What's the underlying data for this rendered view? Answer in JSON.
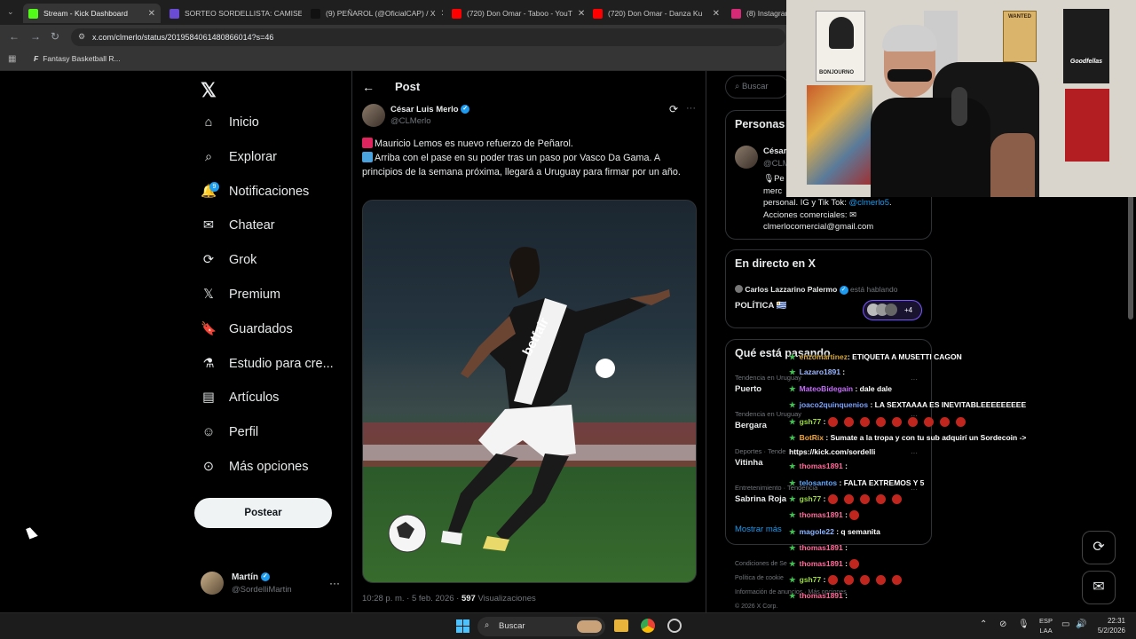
{
  "browser": {
    "tabs": [
      {
        "title": "Stream - Kick Dashboard",
        "color": "#53fc18"
      },
      {
        "title": "SORTEO SORDELLISTA: CAMISE",
        "color": "#6a4bd6"
      },
      {
        "title": "(9) PEÑAROL (@OficialCAP) / X",
        "color": "#111111"
      },
      {
        "title": "(720) Don Omar - Taboo - YouT",
        "color": "#ff0000"
      },
      {
        "title": "(720) Don Omar - Danza Ku",
        "color": "#ff0000"
      },
      {
        "title": "(8) Instagram",
        "color": "#d62976"
      }
    ],
    "url": "x.com/clmerlo/status/2019584061480866014?s=46",
    "bookmark": "Fantasy Basketball R..."
  },
  "nav": {
    "items": [
      {
        "label": "Inicio",
        "icon": "home-icon"
      },
      {
        "label": "Explorar",
        "icon": "search-icon"
      },
      {
        "label": "Notificaciones",
        "icon": "bell-icon"
      },
      {
        "label": "Chatear",
        "icon": "mail-icon"
      },
      {
        "label": "Grok",
        "icon": "grok-icon"
      },
      {
        "label": "Premium",
        "icon": "x-logo-icon"
      },
      {
        "label": "Guardados",
        "icon": "bookmark-icon"
      },
      {
        "label": "Estudio para cre...",
        "icon": "flask-icon"
      },
      {
        "label": "Artículos",
        "icon": "article-icon"
      },
      {
        "label": "Perfil",
        "icon": "person-icon"
      },
      {
        "label": "Más opciones",
        "icon": "more-icon"
      }
    ],
    "notification_badge": "9",
    "post_button": "Postear",
    "account": {
      "name": "Martín",
      "handle": "@SordelliMartin"
    }
  },
  "post": {
    "header": "Post",
    "author": "César Luis Merlo",
    "handle": "@CLMerlo",
    "line1": "Mauricio Lemos es nuevo refuerzo de Peñarol.",
    "line2": "Arriba con el pase en su poder tras un paso por Vasco Da Gama. A principios de la semana próxima, llegará a Uruguay para firmar por un año.",
    "timestamp": "10:28 p. m. · 5 feb. 2026 · ",
    "views_count": "597",
    "views_label": "Visualizaciones",
    "jersey_text": "betfair"
  },
  "right": {
    "search_placeholder": "Buscar",
    "personas_title": "Personas",
    "person_name": "César",
    "person_handle": "@CLM",
    "bio1": "Pe",
    "bio2": "merc",
    "bio3": "personal. IG y Tik Tok: ",
    "bio_link": "@clmerlo5",
    "bio4": "Acciones comerciales: ",
    "bio5": "clmerlocomercial@gmail.com",
    "live_title": "En directo en X",
    "live_host": "Carlos Lazzarino Palermo",
    "live_status": "está hablando",
    "live_topic": "POLÍTICA",
    "live_count": "+4",
    "trends_title": "Qué está pasando",
    "trends": [
      {
        "context": "Tendencia en Uruguay",
        "name": "Puerto"
      },
      {
        "context": "Tendencia en Uruguay",
        "name": "Bergara"
      },
      {
        "context": "Deportes · Tende",
        "name": "Vitinha"
      },
      {
        "context": "Entretenimiento · Tendencia",
        "name": "Sabrina Roja"
      }
    ],
    "show_more": "Mostrar más",
    "footer1": "Condiciones de Se",
    "footer2": "Política de cookie",
    "footer3": "Información de anuncios",
    "footer3b": "Más opciones",
    "footer4": "© 2026 X Corp."
  },
  "webcam": {
    "poster_left": "BONJOURNO",
    "poster_wanted": "WANTED",
    "poster_goodfellas": "Goodfellas"
  },
  "chat": [
    {
      "user": "enzomartinez",
      "msg": ": ETIQUETA A MUSETTI CAGON",
      "color": "#d6a636",
      "emotes": 0
    },
    {
      "user": "Lazaro1891",
      "msg": " : ",
      "color": "#9bb7ff",
      "emotes": 0
    },
    {
      "user": "MateoBidegain",
      "msg": " : dale dale",
      "color": "#c86bff",
      "emotes": 0
    },
    {
      "user": "joaco2quinquenios",
      "msg": " : LA SEXTAAAA ES INEVITABLEEEEEEEEE",
      "color": "#7aa2ff",
      "emotes": 0
    },
    {
      "user": "gsh77",
      "msg": " : ",
      "color": "#9cdc3b",
      "emotes": 9
    },
    {
      "user": "BotRix",
      "msg": " : Sumate a la tropa y con tu sub adquirí un Sordecoin ->",
      "color": "#f0a63b",
      "emotes": 0
    },
    {
      "user": "",
      "msg": "https://kick.com/sordelli",
      "color": "#ffffff",
      "emotes": 0
    },
    {
      "user": "thomas1891",
      "msg": " : ",
      "color": "#ff6b9b",
      "emotes": 0
    },
    {
      "user": "telosantos",
      "msg": " : FALTA EXTREMOS Y 5",
      "color": "#5fa8ff",
      "emotes": 0
    },
    {
      "user": "gsh77",
      "msg": " : ",
      "color": "#9cdc3b",
      "emotes": 5
    },
    {
      "user": "thomas1891",
      "msg": " : ",
      "color": "#ff6b9b",
      "emotes": 1
    },
    {
      "user": "magole22",
      "msg": " : q semanita",
      "color": "#8ab4ff",
      "emotes": 0
    },
    {
      "user": "thomas1891",
      "msg": " : ",
      "color": "#ff6b9b",
      "emotes": 0
    },
    {
      "user": "thomas1891",
      "msg": " : ",
      "color": "#ff6b9b",
      "emotes": 1
    },
    {
      "user": "gsh77",
      "msg": " : ",
      "color": "#9cdc3b",
      "emotes": 5
    },
    {
      "user": "thomas1891",
      "msg": " : ",
      "color": "#ff6b9b",
      "emotes": 0
    }
  ],
  "taskbar": {
    "search": "Buscar",
    "lang1": "ESP",
    "lang2": "LAA",
    "time": "22:31",
    "date": "5/2/2026"
  }
}
